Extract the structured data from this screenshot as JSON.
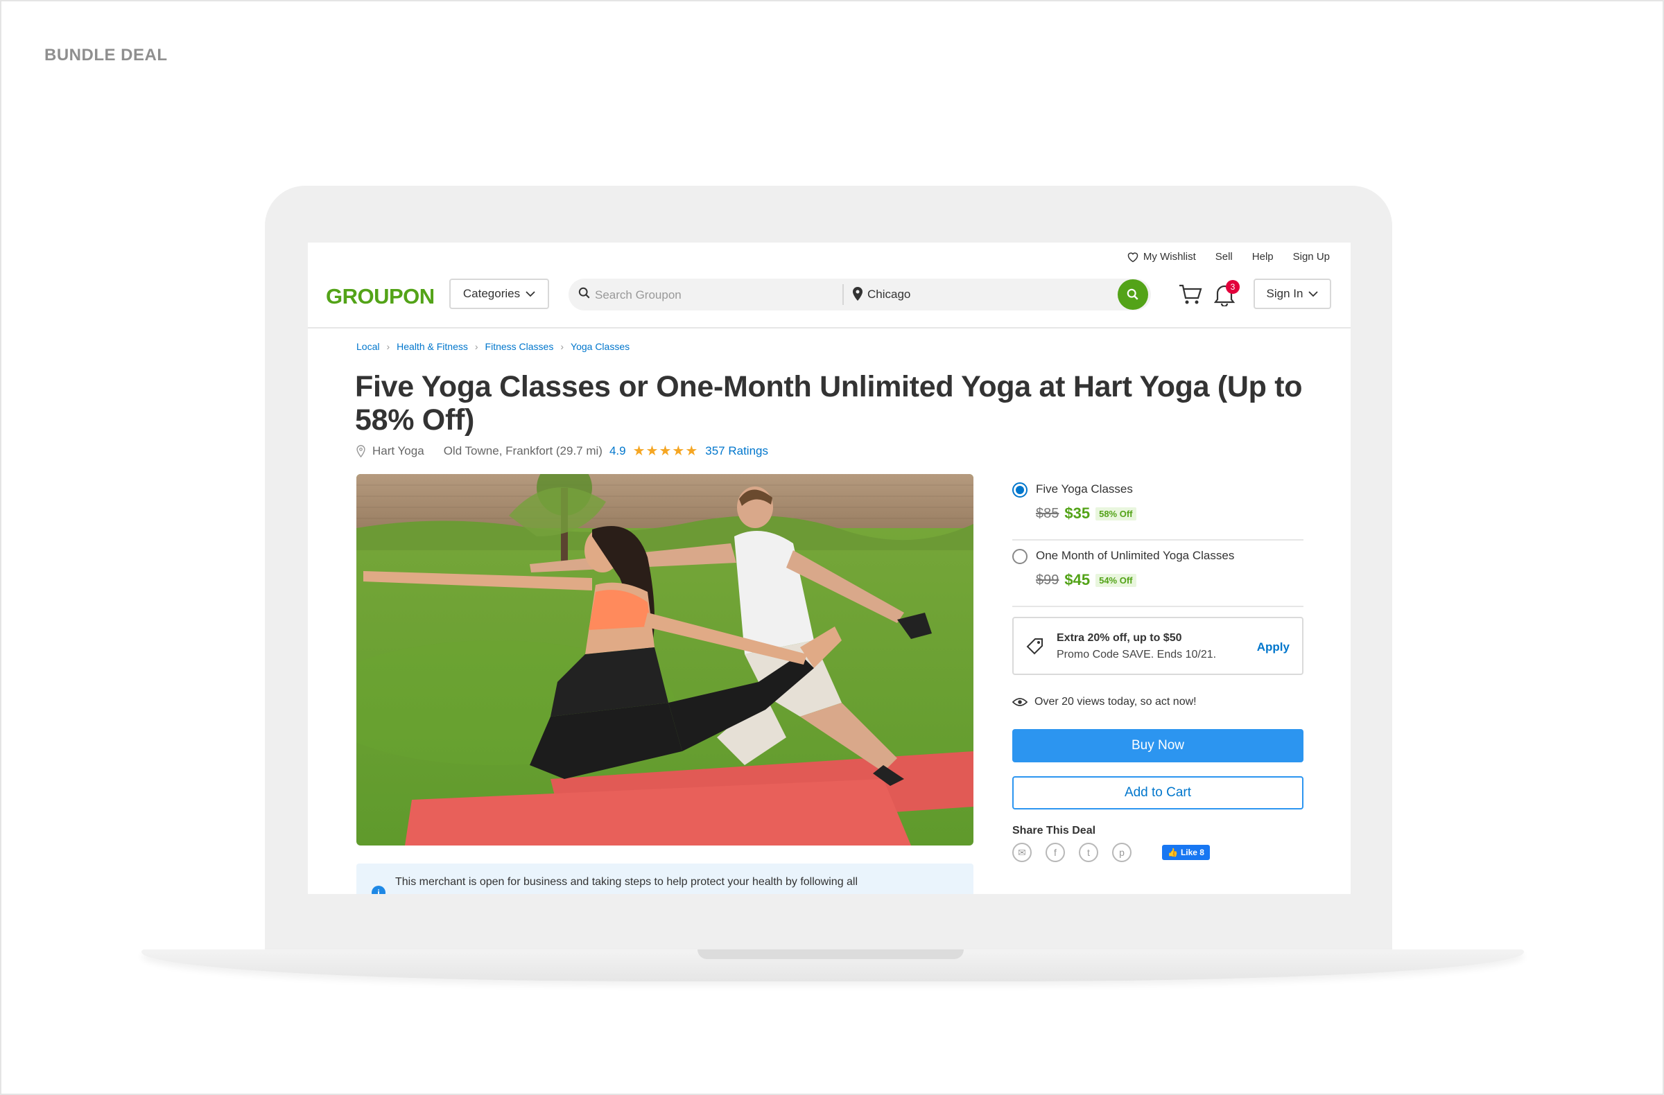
{
  "label": "BUNDLE DEAL",
  "topbar": {
    "wishlist": "My Wishlist",
    "sell": "Sell",
    "help": "Help",
    "signup": "Sign Up"
  },
  "header": {
    "logo": "GROUPON",
    "categories": "Categories",
    "search_placeholder": "Search Groupon",
    "location": "Chicago",
    "notification_count": "3",
    "signin": "Sign In",
    "brand_color": "#53a318"
  },
  "breadcrumb": [
    "Local",
    "Health & Fitness",
    "Fitness Classes",
    "Yoga Classes"
  ],
  "deal": {
    "title": "Five Yoga Classes or One-Month Unlimited Yoga at Hart Yoga (Up to 58% Off)",
    "merchant": "Hart Yoga",
    "location": "Old Towne, Frankfort (29.7 mi)",
    "rating": "4.9",
    "stars": "★★★★★",
    "ratings_count": "357 Ratings"
  },
  "options": [
    {
      "name": "Five Yoga Classes",
      "old_price": "$85",
      "new_price": "$35",
      "discount": "58% Off",
      "selected": true
    },
    {
      "name": "One Month of Unlimited Yoga Classes",
      "old_price": "$99",
      "new_price": "$45",
      "discount": "54% Off",
      "selected": false
    }
  ],
  "promo": {
    "line1": "Extra 20% off, up to $50",
    "line2": "Promo Code SAVE. Ends 10/21.",
    "apply": "Apply"
  },
  "views_text": "Over 20 views today, so act now!",
  "buttons": {
    "buy": "Buy Now",
    "add_to_cart": "Add to Cart"
  },
  "share": {
    "title": "Share This Deal",
    "fb_like": "Like 8"
  },
  "notice": "This merchant is open for business and taking steps to help protect your health by following all"
}
